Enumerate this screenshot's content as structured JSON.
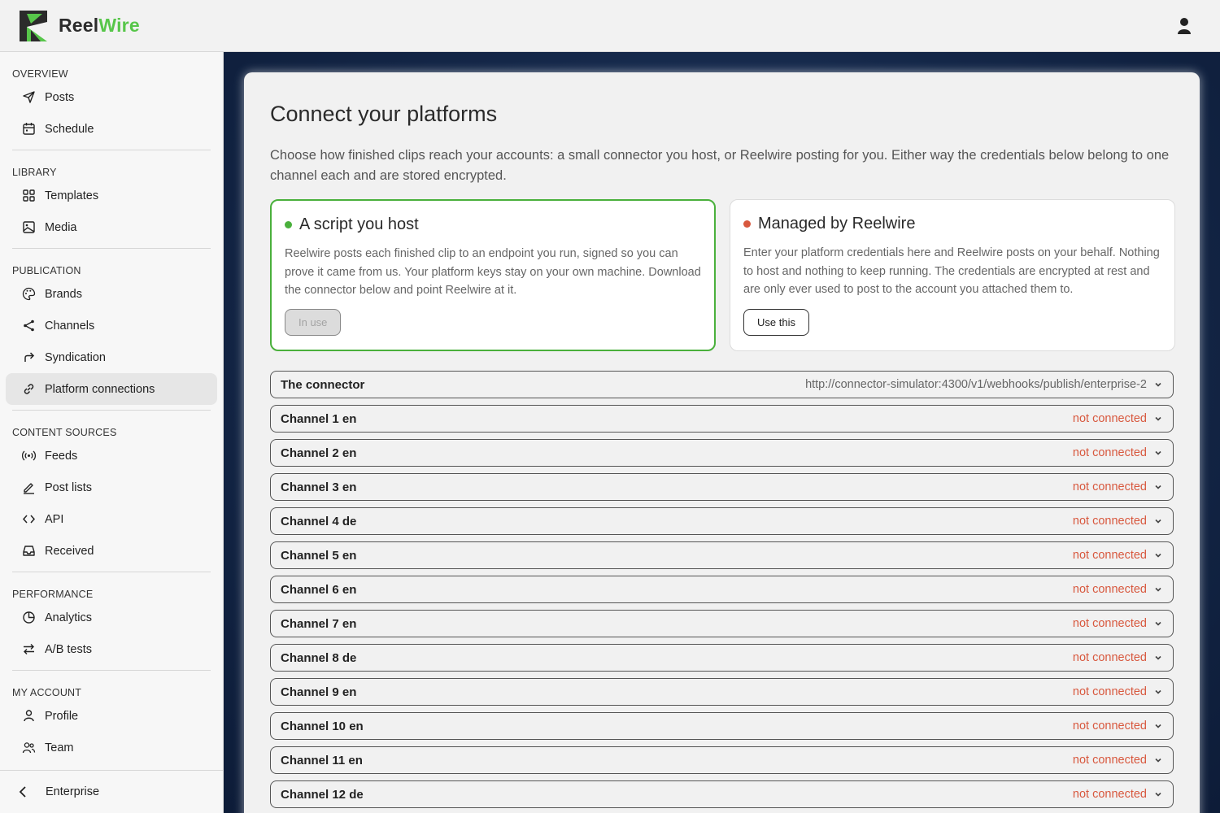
{
  "app": {
    "brand_part1": "Reel",
    "brand_part2": "Wire",
    "colors": {
      "accent_green": "#57c64a",
      "status_red": "#d8583e",
      "sidebar_active": "#e6e6e6",
      "main_bg": "#142748"
    }
  },
  "header": {
    "user_icon": "user-icon"
  },
  "sidebar": {
    "sections": [
      {
        "title": "OVERVIEW",
        "items": [
          {
            "label": "Posts",
            "icon": "send-icon"
          },
          {
            "label": "Schedule",
            "icon": "calendar-icon"
          }
        ]
      },
      {
        "title": "LIBRARY",
        "items": [
          {
            "label": "Templates",
            "icon": "grid-icon"
          },
          {
            "label": "Media",
            "icon": "image-icon"
          }
        ]
      },
      {
        "title": "PUBLICATION",
        "items": [
          {
            "label": "Brands",
            "icon": "palette-icon"
          },
          {
            "label": "Channels",
            "icon": "share-icon"
          },
          {
            "label": "Syndication",
            "icon": "forward-icon"
          },
          {
            "label": "Platform connections",
            "icon": "link-icon",
            "active": true
          }
        ]
      },
      {
        "title": "CONTENT SOURCES",
        "items": [
          {
            "label": "Feeds",
            "icon": "broadcast-icon"
          },
          {
            "label": "Post lists",
            "icon": "pen-icon"
          },
          {
            "label": "API",
            "icon": "code-icon"
          },
          {
            "label": "Received",
            "icon": "inbox-icon"
          }
        ]
      },
      {
        "title": "PERFORMANCE",
        "items": [
          {
            "label": "Analytics",
            "icon": "pie-chart-icon"
          },
          {
            "label": "A/B tests",
            "icon": "swap-icon"
          }
        ]
      },
      {
        "title": "MY ACCOUNT",
        "items": [
          {
            "label": "Profile",
            "icon": "person-icon"
          },
          {
            "label": "Team",
            "icon": "team-icon"
          }
        ]
      }
    ],
    "footer_label": "Enterprise"
  },
  "main": {
    "title": "Connect your platforms",
    "intro": "Choose how finished clips reach your accounts: a small connector you host, or Reelwire posting for you. Either way the credentials below belong to one channel each and are stored encrypted.",
    "options": [
      {
        "title": "A script you host",
        "description": "Reelwire posts each finished clip to an endpoint you run, signed so you can prove it came from us. Your platform keys stay on your own machine. Download the connector below and point Reelwire at it.",
        "button": "In use",
        "dot_color": "#4ab03c"
      },
      {
        "title": "Managed by Reelwire",
        "description": "Enter your platform credentials here and Reelwire posts on your behalf. Nothing to host and nothing to keep running. The credentials are encrypted at rest and are only ever used to post to the account you attached them to.",
        "button": "Use this",
        "dot_color": "#d8583e"
      }
    ],
    "connector": {
      "label": "The connector",
      "value": "http://connector-simulator:4300/v1/webhooks/publish/enterprise-2"
    },
    "channels": [
      {
        "label": "Channel 1 en",
        "status": "not connected"
      },
      {
        "label": "Channel 2 en",
        "status": "not connected"
      },
      {
        "label": "Channel 3 en",
        "status": "not connected"
      },
      {
        "label": "Channel 4 de",
        "status": "not connected"
      },
      {
        "label": "Channel 5 en",
        "status": "not connected"
      },
      {
        "label": "Channel 6 en",
        "status": "not connected"
      },
      {
        "label": "Channel 7 en",
        "status": "not connected"
      },
      {
        "label": "Channel 8 de",
        "status": "not connected"
      },
      {
        "label": "Channel 9 en",
        "status": "not connected"
      },
      {
        "label": "Channel 10 en",
        "status": "not connected"
      },
      {
        "label": "Channel 11 en",
        "status": "not connected"
      },
      {
        "label": "Channel 12 de",
        "status": "not connected"
      }
    ]
  }
}
